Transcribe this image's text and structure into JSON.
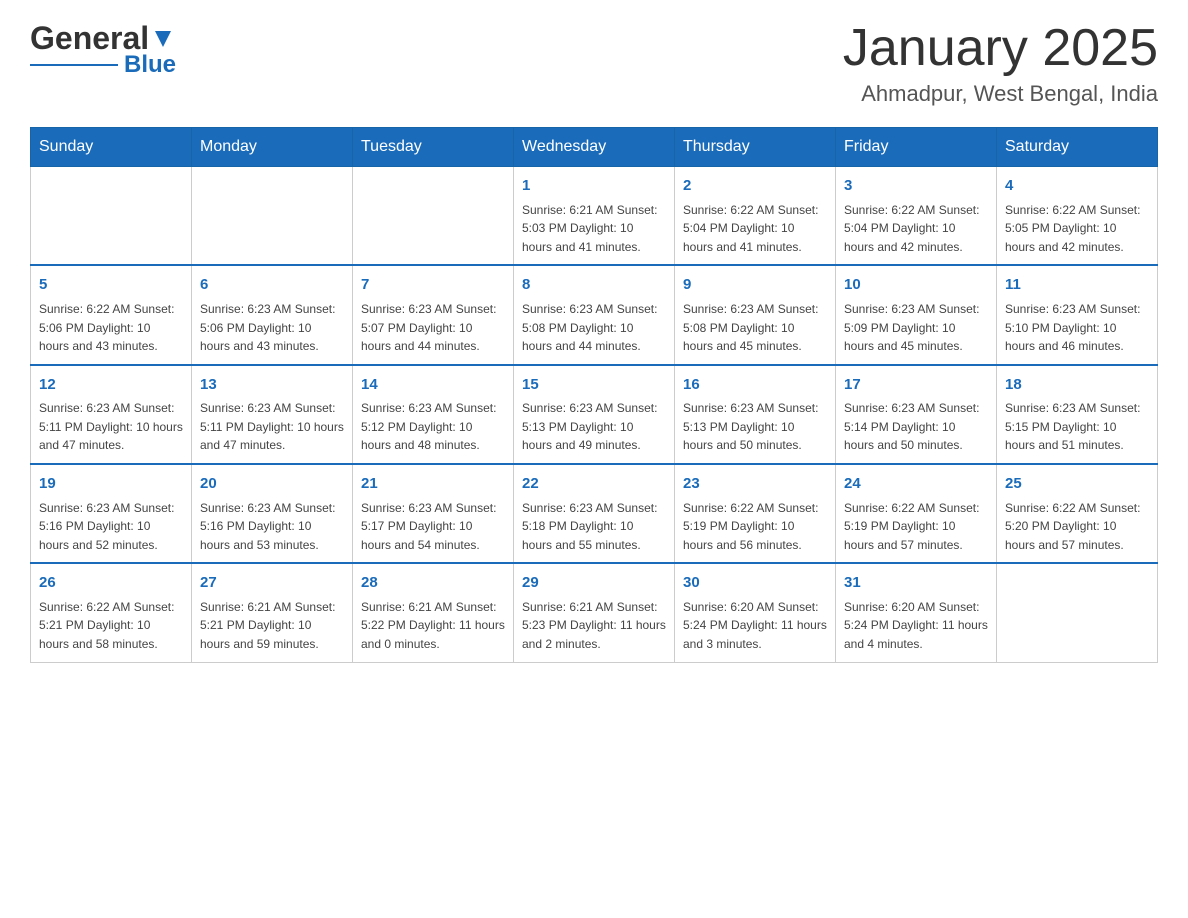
{
  "header": {
    "logo_line1": "General",
    "logo_line2": "Blue",
    "title": "January 2025",
    "subtitle": "Ahmadpur, West Bengal, India"
  },
  "weekdays": [
    "Sunday",
    "Monday",
    "Tuesday",
    "Wednesday",
    "Thursday",
    "Friday",
    "Saturday"
  ],
  "weeks": [
    [
      {
        "day": "",
        "info": ""
      },
      {
        "day": "",
        "info": ""
      },
      {
        "day": "",
        "info": ""
      },
      {
        "day": "1",
        "info": "Sunrise: 6:21 AM\nSunset: 5:03 PM\nDaylight: 10 hours\nand 41 minutes."
      },
      {
        "day": "2",
        "info": "Sunrise: 6:22 AM\nSunset: 5:04 PM\nDaylight: 10 hours\nand 41 minutes."
      },
      {
        "day": "3",
        "info": "Sunrise: 6:22 AM\nSunset: 5:04 PM\nDaylight: 10 hours\nand 42 minutes."
      },
      {
        "day": "4",
        "info": "Sunrise: 6:22 AM\nSunset: 5:05 PM\nDaylight: 10 hours\nand 42 minutes."
      }
    ],
    [
      {
        "day": "5",
        "info": "Sunrise: 6:22 AM\nSunset: 5:06 PM\nDaylight: 10 hours\nand 43 minutes."
      },
      {
        "day": "6",
        "info": "Sunrise: 6:23 AM\nSunset: 5:06 PM\nDaylight: 10 hours\nand 43 minutes."
      },
      {
        "day": "7",
        "info": "Sunrise: 6:23 AM\nSunset: 5:07 PM\nDaylight: 10 hours\nand 44 minutes."
      },
      {
        "day": "8",
        "info": "Sunrise: 6:23 AM\nSunset: 5:08 PM\nDaylight: 10 hours\nand 44 minutes."
      },
      {
        "day": "9",
        "info": "Sunrise: 6:23 AM\nSunset: 5:08 PM\nDaylight: 10 hours\nand 45 minutes."
      },
      {
        "day": "10",
        "info": "Sunrise: 6:23 AM\nSunset: 5:09 PM\nDaylight: 10 hours\nand 45 minutes."
      },
      {
        "day": "11",
        "info": "Sunrise: 6:23 AM\nSunset: 5:10 PM\nDaylight: 10 hours\nand 46 minutes."
      }
    ],
    [
      {
        "day": "12",
        "info": "Sunrise: 6:23 AM\nSunset: 5:11 PM\nDaylight: 10 hours\nand 47 minutes."
      },
      {
        "day": "13",
        "info": "Sunrise: 6:23 AM\nSunset: 5:11 PM\nDaylight: 10 hours\nand 47 minutes."
      },
      {
        "day": "14",
        "info": "Sunrise: 6:23 AM\nSunset: 5:12 PM\nDaylight: 10 hours\nand 48 minutes."
      },
      {
        "day": "15",
        "info": "Sunrise: 6:23 AM\nSunset: 5:13 PM\nDaylight: 10 hours\nand 49 minutes."
      },
      {
        "day": "16",
        "info": "Sunrise: 6:23 AM\nSunset: 5:13 PM\nDaylight: 10 hours\nand 50 minutes."
      },
      {
        "day": "17",
        "info": "Sunrise: 6:23 AM\nSunset: 5:14 PM\nDaylight: 10 hours\nand 50 minutes."
      },
      {
        "day": "18",
        "info": "Sunrise: 6:23 AM\nSunset: 5:15 PM\nDaylight: 10 hours\nand 51 minutes."
      }
    ],
    [
      {
        "day": "19",
        "info": "Sunrise: 6:23 AM\nSunset: 5:16 PM\nDaylight: 10 hours\nand 52 minutes."
      },
      {
        "day": "20",
        "info": "Sunrise: 6:23 AM\nSunset: 5:16 PM\nDaylight: 10 hours\nand 53 minutes."
      },
      {
        "day": "21",
        "info": "Sunrise: 6:23 AM\nSunset: 5:17 PM\nDaylight: 10 hours\nand 54 minutes."
      },
      {
        "day": "22",
        "info": "Sunrise: 6:23 AM\nSunset: 5:18 PM\nDaylight: 10 hours\nand 55 minutes."
      },
      {
        "day": "23",
        "info": "Sunrise: 6:22 AM\nSunset: 5:19 PM\nDaylight: 10 hours\nand 56 minutes."
      },
      {
        "day": "24",
        "info": "Sunrise: 6:22 AM\nSunset: 5:19 PM\nDaylight: 10 hours\nand 57 minutes."
      },
      {
        "day": "25",
        "info": "Sunrise: 6:22 AM\nSunset: 5:20 PM\nDaylight: 10 hours\nand 57 minutes."
      }
    ],
    [
      {
        "day": "26",
        "info": "Sunrise: 6:22 AM\nSunset: 5:21 PM\nDaylight: 10 hours\nand 58 minutes."
      },
      {
        "day": "27",
        "info": "Sunrise: 6:21 AM\nSunset: 5:21 PM\nDaylight: 10 hours\nand 59 minutes."
      },
      {
        "day": "28",
        "info": "Sunrise: 6:21 AM\nSunset: 5:22 PM\nDaylight: 11 hours\nand 0 minutes."
      },
      {
        "day": "29",
        "info": "Sunrise: 6:21 AM\nSunset: 5:23 PM\nDaylight: 11 hours\nand 2 minutes."
      },
      {
        "day": "30",
        "info": "Sunrise: 6:20 AM\nSunset: 5:24 PM\nDaylight: 11 hours\nand 3 minutes."
      },
      {
        "day": "31",
        "info": "Sunrise: 6:20 AM\nSunset: 5:24 PM\nDaylight: 11 hours\nand 4 minutes."
      },
      {
        "day": "",
        "info": ""
      }
    ]
  ]
}
